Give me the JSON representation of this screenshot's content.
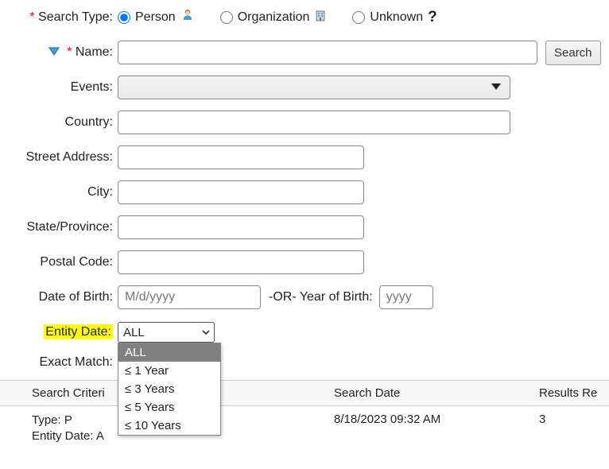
{
  "searchType": {
    "label": "Search Type:",
    "options": {
      "person": "Person",
      "organization": "Organization",
      "unknown": "Unknown"
    },
    "selected": "person"
  },
  "name": {
    "label": "Name:"
  },
  "searchButton": "Search",
  "events": {
    "label": "Events:"
  },
  "country": {
    "label": "Country:"
  },
  "street": {
    "label": "Street Address:"
  },
  "city": {
    "label": "City:"
  },
  "state": {
    "label": "State/Province:"
  },
  "postal": {
    "label": "Postal Code:"
  },
  "dob": {
    "label": "Date of Birth:",
    "placeholder": "M/d/yyyy"
  },
  "orLabel": "-OR- Year of Birth:",
  "yob": {
    "placeholder": "yyyy"
  },
  "entityDate": {
    "label": "Entity Date:",
    "selected": "ALL",
    "options": [
      "ALL",
      "≤ 1 Year",
      "≤ 3 Years",
      "≤ 5 Years",
      "≤ 10 Years"
    ]
  },
  "exactMatch": {
    "label": "Exact Match:"
  },
  "resultsTable": {
    "headers": {
      "criteria": "Search Criteri",
      "date": "Search Date",
      "results": "Results Re"
    },
    "row": {
      "criteriaLine1": "Type: P",
      "criteriaLine2": "Entity Date: A",
      "date": "8/18/2023 09:32 AM",
      "results": "3"
    }
  }
}
